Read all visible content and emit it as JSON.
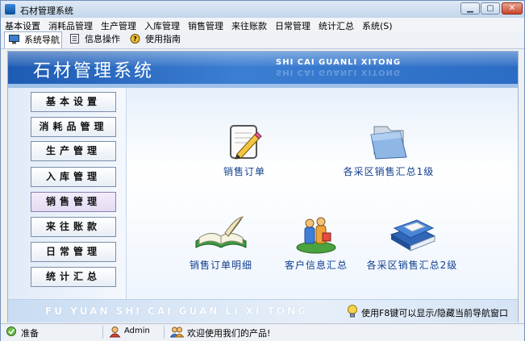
{
  "window": {
    "title": "石材管理系统"
  },
  "menu": [
    "基本设置",
    "消耗品管理",
    "生产管理",
    "入库管理",
    "销售管理",
    "来往账款",
    "日常管理",
    "统计汇总",
    "系统(S)"
  ],
  "tabs": [
    {
      "label": "系统导航",
      "icon": "monitor-icon"
    },
    {
      "label": "信息操作",
      "icon": "document-icon"
    },
    {
      "label": "使用指南",
      "icon": "help-icon"
    }
  ],
  "header": {
    "title": "石材管理系统",
    "subtitle": "SHI CAI GUANLI XITONG"
  },
  "nav": [
    "基本设置",
    "消耗品管理",
    "生产管理",
    "入库管理",
    "销售管理",
    "来往账款",
    "日常管理",
    "统计汇总"
  ],
  "selected_nav": "销售管理",
  "tiles": [
    {
      "label": "销售订单",
      "icon": "pencil-paper-icon"
    },
    {
      "label": "各采区销售汇总1级",
      "icon": "folder-icon"
    },
    {
      "label": "销售订单明细",
      "icon": "open-book-icon"
    },
    {
      "label": "客户信息汇总",
      "icon": "people-icon"
    },
    {
      "label": "各采区销售汇总2级",
      "icon": "books-icon"
    }
  ],
  "footer": {
    "slogan": "FU YUAN SHI CAI GUAN LI XI TONG",
    "hint": "使用F8键可以显示/隐藏当前导航窗口"
  },
  "status": {
    "state": "准备",
    "user": "Admin",
    "welcome": "欢迎使用我们的产品!"
  }
}
